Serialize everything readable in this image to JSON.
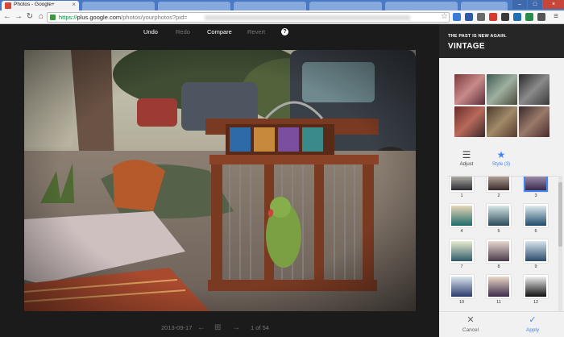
{
  "browser": {
    "tab_title": "Photos - Google+",
    "tab_close": "×",
    "url_scheme": "https://",
    "url_host": "plus.google.com",
    "url_path": "/photos/yourphotos?pid=",
    "window_controls": [
      "–",
      "□",
      "×"
    ]
  },
  "editor": {
    "undo_label": "Undo",
    "redo_label": "Redo",
    "compare_label": "Compare",
    "revert_label": "Revert",
    "help_label": "?",
    "date": "2013-09-17",
    "position": "1 of 54"
  },
  "panel": {
    "tagline": "THE PAST IS NEW AGAIN.",
    "filter_name": "VINTAGE",
    "adjust_label": "Adjust",
    "style_label": "Style (3)",
    "cancel_label": "Cancel",
    "apply_label": "Apply",
    "styles": [
      "1",
      "2",
      "3",
      "4",
      "5",
      "6",
      "7",
      "8",
      "9",
      "10",
      "11",
      "12"
    ],
    "selected_style": "3"
  },
  "colors": {
    "accent": "#4285f4",
    "panel_header": "#262626",
    "editor_bg": "#1b1b1b"
  }
}
